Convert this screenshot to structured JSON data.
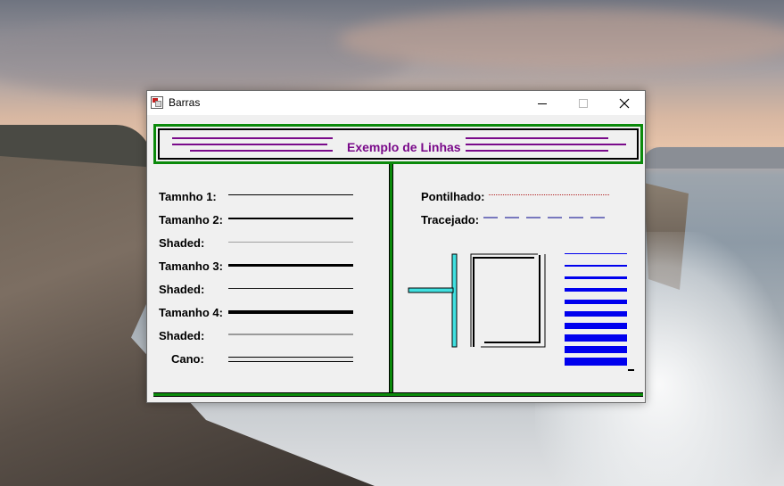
{
  "window": {
    "title": "Barras"
  },
  "header": {
    "title": "Exemplo de Linhas",
    "accent_color": "#7a0a8a",
    "frame_color": "#0b8a0b"
  },
  "left_panel": {
    "rows": [
      {
        "label": "Tamnho 1:",
        "style": "solid-1px"
      },
      {
        "label": "Tamanho 2:",
        "style": "solid-2px"
      },
      {
        "label": "Shaded:",
        "style": "shaded-gray"
      },
      {
        "label": "Tamanho 3:",
        "style": "solid-3px"
      },
      {
        "label": "Shaded:",
        "style": "shaded-dark"
      },
      {
        "label": "Tamanho 4:",
        "style": "solid-4px"
      },
      {
        "label": "Shaded:",
        "style": "shaded-gray-wide"
      },
      {
        "label": "Cano:",
        "style": "pipe"
      }
    ]
  },
  "right_panel": {
    "dotted_label": "Pontilhado:",
    "dashed_label": "Tracejado:",
    "dotted_color": "#b22222",
    "dashed_color": "#00008b",
    "bar_color": "#0000ee",
    "pipe_color": "#40e0e0"
  },
  "icons": [
    "app-icon",
    "minimize-icon",
    "maximize-icon",
    "close-icon"
  ]
}
